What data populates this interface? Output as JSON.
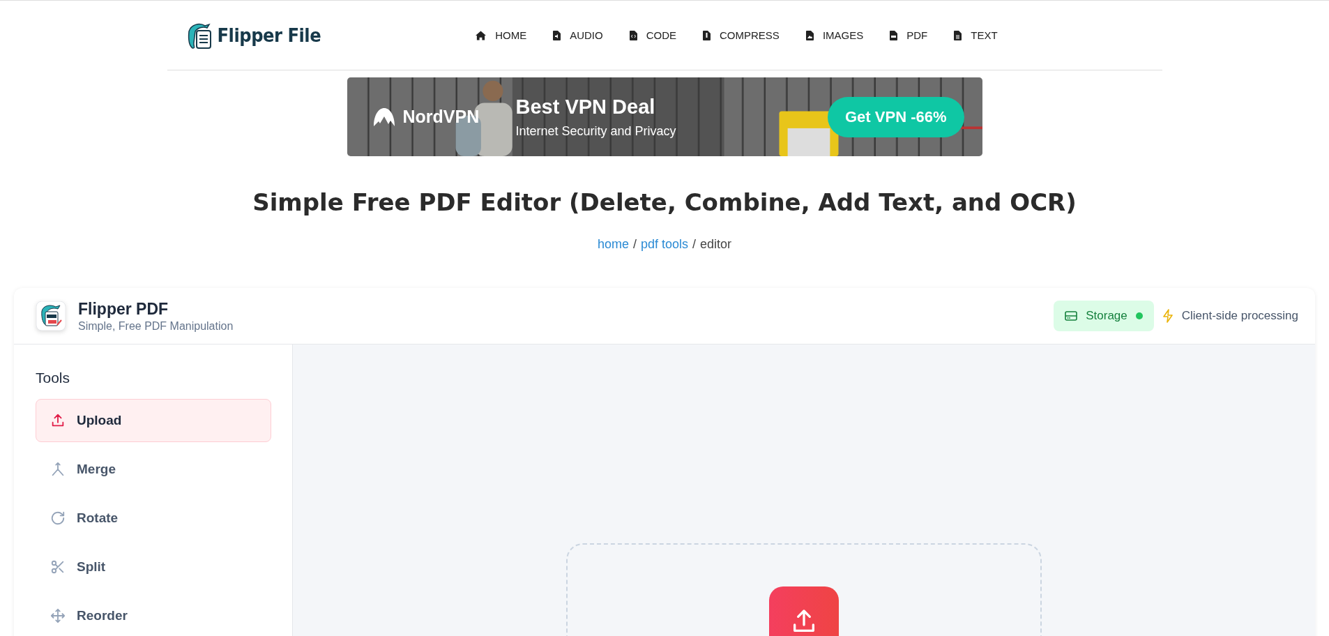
{
  "header": {
    "logo_text": "Flipper File",
    "nav": [
      {
        "label": "HOME",
        "kind": "home"
      },
      {
        "label": "AUDIO",
        "kind": "audio"
      },
      {
        "label": "CODE",
        "kind": "code"
      },
      {
        "label": "COMPRESS",
        "kind": "compress"
      },
      {
        "label": "IMAGES"
      },
      {
        "label": "PDF",
        "kind": "pdf"
      },
      {
        "label": "TEXT",
        "kind": "text"
      }
    ]
  },
  "ad": {
    "brand": "NordVPN",
    "headline": "Best VPN Deal",
    "subline": "Internet Security and Privacy",
    "cta": "Get VPN -66%"
  },
  "page_title": "Simple Free PDF Editor (Delete, Combine, Add Text, and OCR)",
  "breadcrumb": {
    "separator": "/",
    "items": [
      {
        "label": "home",
        "link": true
      },
      {
        "label": "pdf tools",
        "link": true
      },
      {
        "label": "editor",
        "link": false
      }
    ]
  },
  "app": {
    "name": "Flipper PDF",
    "tagline": "Simple, Free PDF Manipulation",
    "storage": {
      "label": "Storage",
      "online": true
    },
    "processing": "Client-side processing",
    "sidebar": {
      "title": "Tools",
      "items": [
        {
          "label": "Upload",
          "kind": "upload",
          "selected": true
        },
        {
          "label": "Merge",
          "kind": "merge",
          "selected": false
        },
        {
          "label": "Rotate",
          "kind": "rotate",
          "selected": false
        },
        {
          "label": "Split",
          "kind": "split",
          "selected": false
        },
        {
          "label": "Reorder",
          "kind": "move",
          "selected": false
        }
      ]
    }
  }
}
